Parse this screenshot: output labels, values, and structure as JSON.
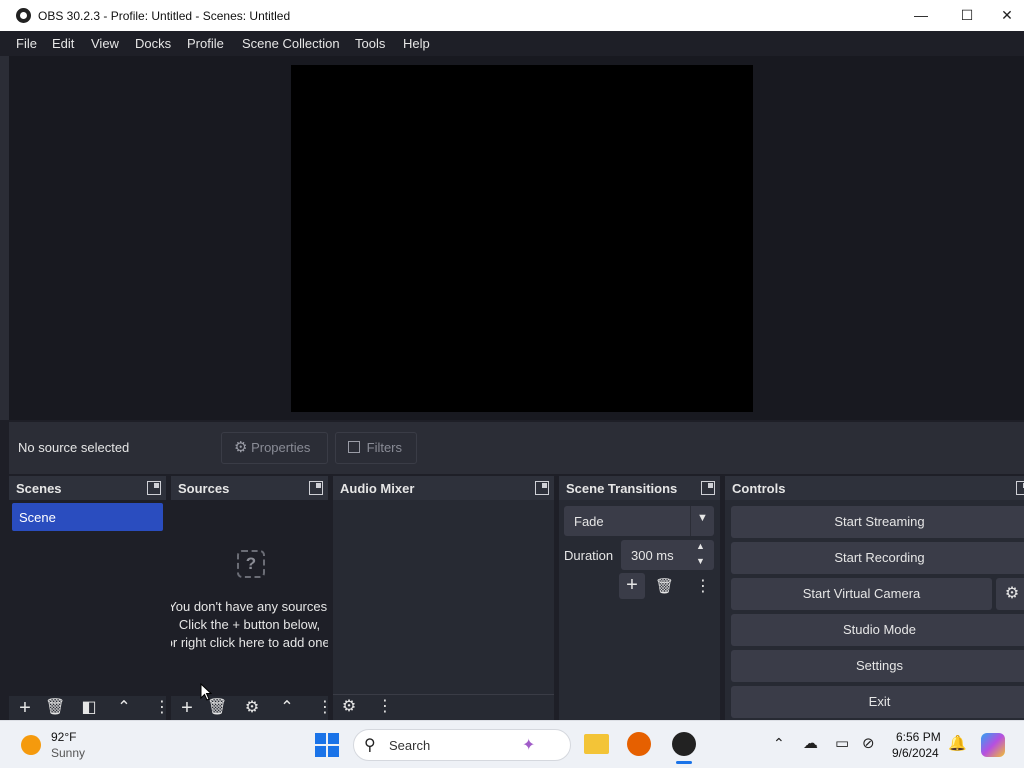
{
  "window": {
    "title": "OBS 30.2.3 - Profile: Untitled - Scenes: Untitled",
    "minimize": "—",
    "maximize": "☐",
    "close": "✕"
  },
  "menu": [
    "File",
    "Edit",
    "View",
    "Docks",
    "Profile",
    "Scene Collection",
    "Tools",
    "Help"
  ],
  "source_bar": {
    "status": "No source selected",
    "properties_label": "Properties",
    "filters_label": "Filters"
  },
  "docks": {
    "scenes": {
      "title": "Scenes",
      "items": [
        "Scene"
      ]
    },
    "sources": {
      "title": "Sources",
      "empty_lines": [
        "You don't have any sources.",
        "Click the + button below,",
        "or right click here to add one."
      ]
    },
    "audio_mixer": {
      "title": "Audio Mixer"
    },
    "transitions": {
      "title": "Scene Transitions",
      "selected": "Fade",
      "duration_label": "Duration",
      "duration_value": "300 ms"
    },
    "controls": {
      "title": "Controls",
      "buttons": [
        "Start Streaming",
        "Start Recording",
        "Start Virtual Camera",
        "Studio Mode",
        "Settings",
        "Exit"
      ]
    }
  },
  "taskbar": {
    "weather_temp": "92°F",
    "weather_desc": "Sunny",
    "search_placeholder": "Search",
    "time": "6:56 PM",
    "date": "9/6/2024"
  },
  "colors": {
    "accent": "#2a4dbf",
    "panel": "#272a33",
    "background": "#1e1f27"
  }
}
